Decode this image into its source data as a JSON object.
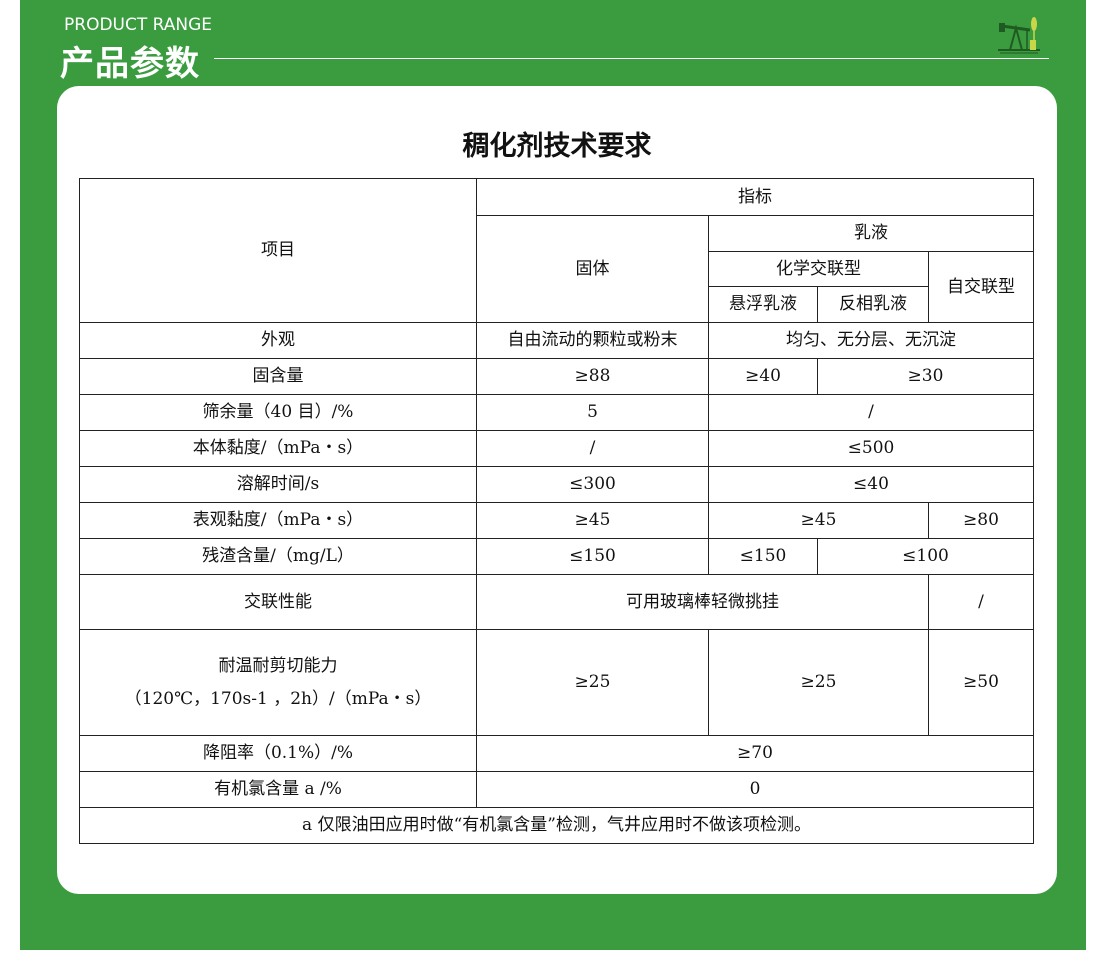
{
  "header": {
    "subtitle_en": "PRODUCT RANGE",
    "title_cn": "产品参数",
    "logo_icon": "oil-pump-icon"
  },
  "colors": {
    "panel_green": "#3a9c3f",
    "card_white": "#ffffff",
    "border": "#222222"
  },
  "table": {
    "title": "稠化剂技术要求",
    "head": {
      "item": "项目",
      "indicator": "指标",
      "solid": "固体",
      "emulsion": "乳液",
      "chem_crosslink": "化学交联型",
      "self_crosslink": "自交联型",
      "suspension_emulsion": "悬浮乳液",
      "inverse_emulsion": "反相乳液"
    },
    "rows": {
      "appearance": {
        "label": "外观",
        "solid": "自由流动的颗粒或粉末",
        "emulsion": "均匀、无分层、无沉淀"
      },
      "solid_content": {
        "label": "固含量",
        "solid": "≥88",
        "suspension": "≥40",
        "rest": "≥30"
      },
      "sieve": {
        "label": "筛余量（40 目）/%",
        "solid": "5",
        "emulsion": "/"
      },
      "body_viscosity": {
        "label": "本体黏度/（mPa・s）",
        "solid": "/",
        "emulsion": "≤500"
      },
      "dissolve_time": {
        "label": "溶解时间/s",
        "solid": "≤300",
        "emulsion": "≤40"
      },
      "apparent_viscosity": {
        "label": "表观黏度/（mPa・s）",
        "solid": "≥45",
        "chem": "≥45",
        "self": "≥80"
      },
      "residue": {
        "label": "残渣含量/（mg/L）",
        "solid": "≤150",
        "suspension": "≤150",
        "rest": "≤100"
      },
      "crosslink": {
        "label": "交联性能",
        "solid_chem": "可用玻璃棒轻微挑挂",
        "self": "/"
      },
      "heat_shear": {
        "label_line1": "耐温耐剪切能力",
        "label_line2": "（120℃，170s-1 ，2h）/（mPa・s）",
        "solid": "≥25",
        "chem": "≥25",
        "self": "≥50"
      },
      "drag_reduction": {
        "label": "降阻率（0.1%）/%",
        "value": "≥70"
      },
      "organochlorine": {
        "label": "有机氯含量 a /%",
        "value": "0"
      },
      "footnote": "a 仅限油田应用时做“有机氯含量”检测，气井应用时不做该项检测。"
    }
  }
}
